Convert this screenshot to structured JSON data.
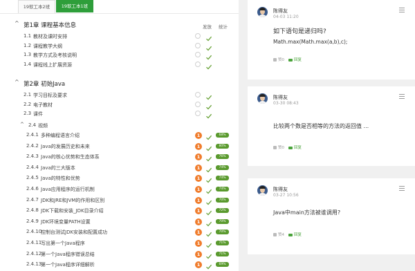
{
  "tabs": [
    "19软工本2班",
    "19软工本1班"
  ],
  "columns": {
    "done": "发放",
    "stats": "统计"
  },
  "chapter1": {
    "title": "第1章 课程基本信息",
    "items": [
      {
        "num": "1.1",
        "label": "教材及课时安排"
      },
      {
        "num": "1.2",
        "label": "课程教学大纲"
      },
      {
        "num": "1.3",
        "label": "教学方式及考核说明"
      },
      {
        "num": "1.4",
        "label": "课程线上扩展资源"
      }
    ]
  },
  "chapter2": {
    "title": "第2章 初始Java",
    "items": [
      {
        "num": "2.1",
        "label": "学习目标及要求"
      },
      {
        "num": "2.2",
        "label": "电子教材"
      },
      {
        "num": "2.3",
        "label": "课件"
      },
      {
        "num": "2.4",
        "label": "视频"
      }
    ],
    "videos": [
      {
        "num": "2.4.1",
        "label": "多种编程语言介绍",
        "badge": "1",
        "progress": "68%"
      },
      {
        "num": "2.4.2",
        "label": "Java的发展历史和未来",
        "badge": "1",
        "progress": "80%"
      },
      {
        "num": "2.4.3",
        "label": "Java的核心优势和生态体系",
        "badge": "1",
        "progress": "76%"
      },
      {
        "num": "2.4.4",
        "label": "Java的三大版本",
        "badge": "1",
        "progress": "74%"
      },
      {
        "num": "2.4.5",
        "label": "Java的特性和优势",
        "badge": "1",
        "progress": "74%"
      },
      {
        "num": "2.4.6",
        "label": "Java应用程序的运行机制",
        "badge": "1",
        "progress": "74%"
      },
      {
        "num": "2.4.7",
        "label": "JDK和JRE和JVM的作用和区别",
        "badge": "1",
        "progress": "70%"
      },
      {
        "num": "2.4.8",
        "label": "JDK下载和安装_JDK目录介绍",
        "badge": "1",
        "progress": "72%"
      },
      {
        "num": "2.4.9",
        "label": "JDK环境变量PATH设置",
        "badge": "1",
        "progress": "70%"
      },
      {
        "num": "2.4.10",
        "label": "控制台测试JDK安装和配置成功",
        "badge": "1",
        "progress": "70%"
      },
      {
        "num": "2.4.11",
        "label": "写出第一个Java程序",
        "badge": "1",
        "progress": "71%"
      },
      {
        "num": "2.4.12",
        "label": "第一个Java程序错误总结",
        "badge": "1",
        "progress": "71%"
      },
      {
        "num": "2.4.13",
        "label": "第一个Java程序详细解析",
        "badge": "1",
        "progress": "69%"
      }
    ]
  },
  "comments": [
    {
      "author": "陈得友",
      "date": "04-03 11:20",
      "question": "如下语句是递归吗?",
      "code": "Math.max(Math.max(a,b),c);",
      "likes": "赞0",
      "reply": "回复"
    },
    {
      "author": "陈得友",
      "date": "03-30 08:43",
      "question": "比较两个数是否相等的方法的返回值 ...",
      "code": "",
      "likes": "赞0",
      "reply": "回复"
    },
    {
      "author": "陈得友",
      "date": "03-27 10:56",
      "question": "Java中main方法被谁调用?",
      "code": "",
      "likes": "赞4",
      "reply": "回复"
    }
  ],
  "colors": {
    "accent": "#2e9e3a",
    "badge": "#f07c2c",
    "progress": "#5a9a2e"
  }
}
